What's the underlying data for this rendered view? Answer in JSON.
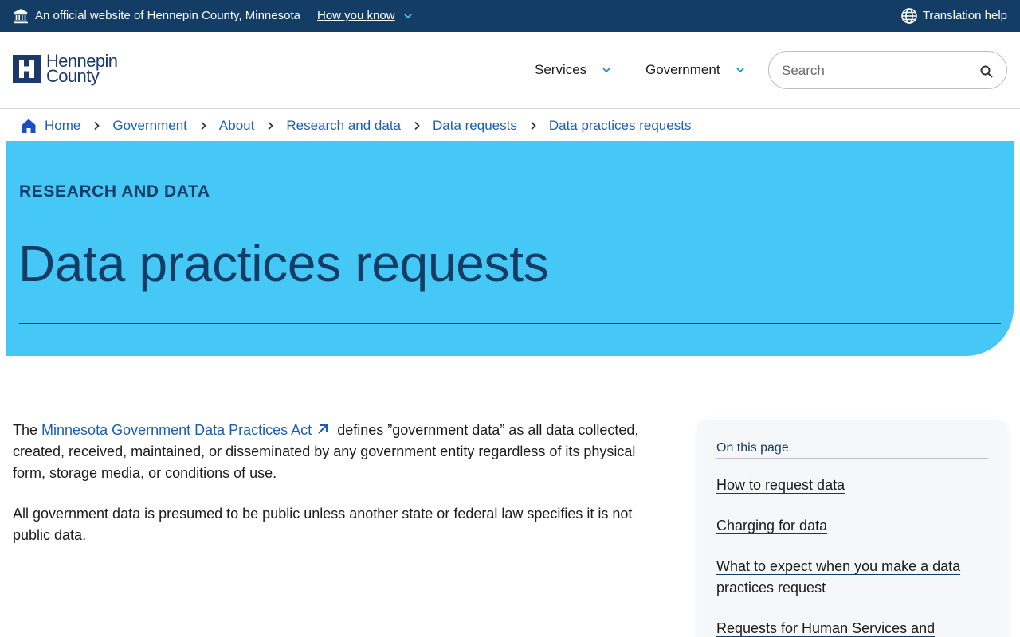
{
  "banner": {
    "official_text": "An official website of Hennepin County, Minnesota",
    "how_you_know": "How you know",
    "translation_help": "Translation help"
  },
  "header": {
    "logo_line1": "Hennepin",
    "logo_line2": "County",
    "nav": [
      {
        "label": "Services"
      },
      {
        "label": "Government"
      }
    ],
    "search": {
      "placeholder": "Search",
      "value": ""
    }
  },
  "breadcrumb": {
    "items": [
      "Home",
      "Government",
      "About",
      "Research and data",
      "Data requests",
      "Data practices requests"
    ]
  },
  "hero": {
    "eyebrow": "RESEARCH AND DATA",
    "title": "Data practices requests"
  },
  "content": {
    "p1_before": "The ",
    "p1_link": "Minnesota Government Data Practices Act",
    "p1_after": "defines ”government data” as all data collected, created, received, maintained, or disseminated by any government entity regardless of its physical form, storage media, or conditions of use.",
    "p2": "All government data is presumed to be public unless another state or federal law specifies it is not public data."
  },
  "toc": {
    "title": "On this page",
    "items": [
      "How to request data",
      "Charging for data",
      "What to expect when you make a data practices request",
      "Requests for Human Services and"
    ]
  },
  "colors": {
    "banner_bg": "#143d66",
    "hero_bg": "#45c8f5",
    "link": "#1a5fb4",
    "brand_navy": "#1b3a6b"
  }
}
